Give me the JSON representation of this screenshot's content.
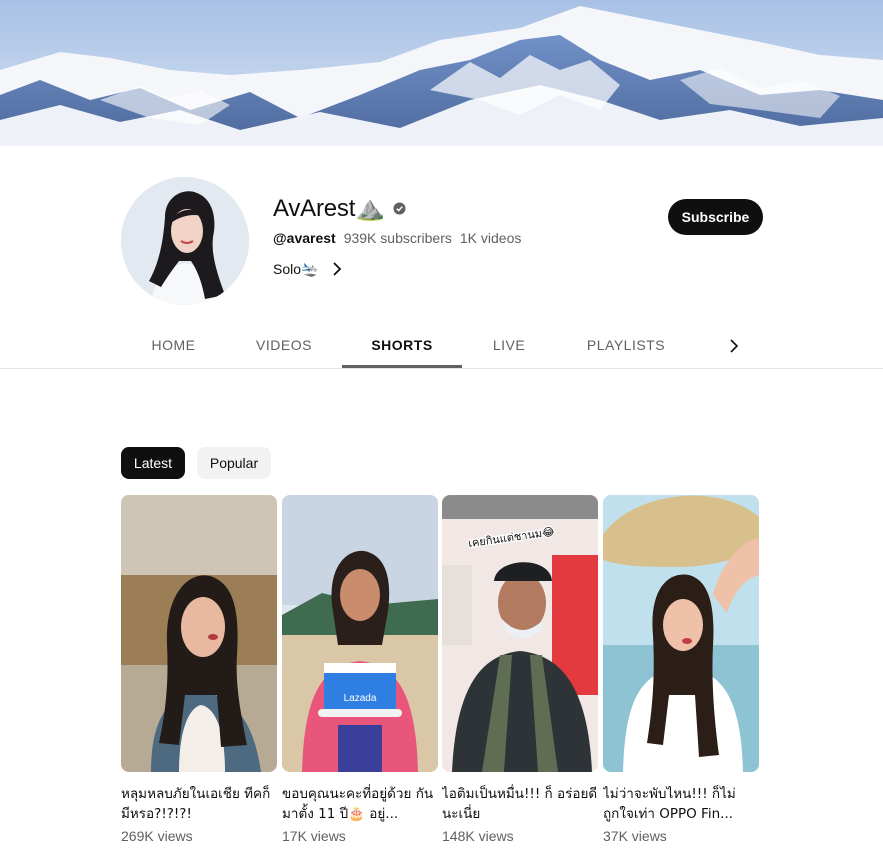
{
  "banner": {
    "description_icon": "mountain-banner"
  },
  "channel": {
    "name": "AvArest⛰️",
    "handle": "@avarest",
    "subscribers": "939K subscribers",
    "videos": "1K videos",
    "about": "Solo🛬"
  },
  "actions": {
    "subscribe_label": "Subscribe"
  },
  "tabs": [
    {
      "label": "HOME",
      "active": false
    },
    {
      "label": "VIDEOS",
      "active": false
    },
    {
      "label": "SHORTS",
      "active": true
    },
    {
      "label": "LIVE",
      "active": false
    },
    {
      "label": "PLAYLISTS",
      "active": false
    }
  ],
  "filters": [
    {
      "label": "Latest",
      "selected": true
    },
    {
      "label": "Popular",
      "selected": false
    }
  ],
  "shorts": [
    {
      "title": "หลุมหลบภัยในเอเชีย ทีคก็มีหรอ?!?!?!",
      "views": "269K views"
    },
    {
      "title": "ขอบคุณนะคะที่อยู่ด้วย กันมาตั้ง 11 ปี🎂 อยู่...",
      "views": "17K views"
    },
    {
      "title": "ไอติมเป็นหมื่น!!! ก็ อร่อยดีนะเนี่ย",
      "views": "148K views"
    },
    {
      "title": "ไม่ว่าจะพับไหน!!! ก็ไม่ ถูกใจเท่า OPPO Fin...",
      "views": "37K views"
    }
  ],
  "thumbnail_text": {
    "short3_caption": "เคยกินแต่ชานม😂",
    "short2_brand": "Lazada"
  },
  "colors": {
    "accent": "#0f0f0f",
    "secondary_text": "#606060",
    "chip_bg": "#f2f2f2"
  }
}
